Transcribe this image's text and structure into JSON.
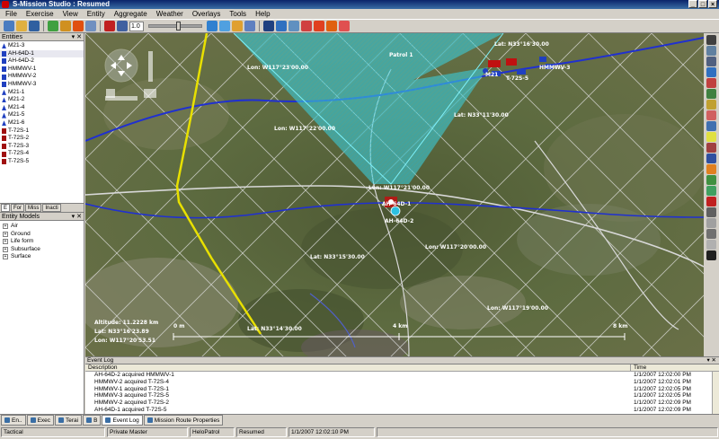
{
  "window": {
    "title": "S-Mission Studio : Resumed"
  },
  "menu": [
    "File",
    "Exercise",
    "View",
    "Entity",
    "Aggregate",
    "Weather",
    "Overlays",
    "Tools",
    "Help"
  ],
  "toolbar": {
    "zoom_value": "1.0"
  },
  "entities_panel": {
    "title": "Entities",
    "items": [
      {
        "label": "M21-3",
        "kind": "blue"
      },
      {
        "label": "AH-64D-1",
        "kind": "heli",
        "selected": true
      },
      {
        "label": "AH-64D-2",
        "kind": "heli"
      },
      {
        "label": "HMMWV-1",
        "kind": "heli"
      },
      {
        "label": "HMMWV-2",
        "kind": "heli"
      },
      {
        "label": "HMMWV-3",
        "kind": "heli"
      },
      {
        "label": "M21-1",
        "kind": "blue"
      },
      {
        "label": "M21-2",
        "kind": "blue"
      },
      {
        "label": "M21-4",
        "kind": "blue"
      },
      {
        "label": "M21-5",
        "kind": "blue"
      },
      {
        "label": "M21-6",
        "kind": "blue"
      },
      {
        "label": "T-72S-1",
        "kind": "red"
      },
      {
        "label": "T-72S-2",
        "kind": "red"
      },
      {
        "label": "T-72S-3",
        "kind": "red"
      },
      {
        "label": "T-72S-4",
        "kind": "red"
      },
      {
        "label": "T-72S-5",
        "kind": "red"
      }
    ]
  },
  "left_tabs": [
    "E",
    "For",
    "Miss",
    "Inacti"
  ],
  "entity_models": {
    "title": "Entity Models",
    "items": [
      "Air",
      "Ground",
      "Life form",
      "Subsurface",
      "Surface"
    ]
  },
  "map": {
    "labels": {
      "lon_1": "Lon: W117°23'00.00",
      "lat_1": "Lat: N33°16'30.00",
      "lon_2": "Lon: W117°22'00.00",
      "lat_2": "Lat: N33°11'30.00",
      "lon_3": "Lon: W117°21'00.00",
      "lon_4": "Lon: W117°20'00.00",
      "lat_3": "Lat: N33°15'30.00",
      "lon_5": "Lon: W117°19'00.00",
      "lat_4": "Lat: N33°14'30.00",
      "patrol": "Patrol 1",
      "unit_m21": "M21",
      "unit_hmmwv": "HMMWV-3",
      "unit_t72": "T-72S-5",
      "unit_ah64d2": "AH-64D-2",
      "unit_ah64d1": "AH-64D-1"
    },
    "readout": {
      "altitude": "Altitude: 11.2228 km",
      "lat": "Lat: N33°16'23.89",
      "lon": "Lon: W117°20'53.51"
    },
    "scale": {
      "left": "0 m",
      "mid": "4 km",
      "right": "8 km"
    }
  },
  "event_log": {
    "title": "Event Log",
    "columns": {
      "description": "Description",
      "time": "Time"
    },
    "rows": [
      {
        "description": "AH-64D-2 acquired HMMWV-1",
        "time": "1/1/2007 12:02:00 PM"
      },
      {
        "description": "HMMWV-2 acquired T-72S-4",
        "time": "1/1/2007 12:02:01 PM"
      },
      {
        "description": "HMMWV-1 acquired T-72S-1",
        "time": "1/1/2007 12:02:05 PM"
      },
      {
        "description": "HMMWV-3 acquired T-72S-5",
        "time": "1/1/2007 12:02:05 PM"
      },
      {
        "description": "HMMWV-2 acquired T-72S-2",
        "time": "1/1/2007 12:02:09 PM"
      },
      {
        "description": "AH-64D-1 acquired T-72S-5",
        "time": "1/1/2007 12:02:09 PM"
      }
    ]
  },
  "bottom_tabs": [
    "En..",
    "Exec",
    "Terai",
    "B",
    "Event Log",
    "Mission Route Properties"
  ],
  "status": {
    "mode": "Tactical",
    "user": "Private Master",
    "mission": "HeloPatrol",
    "state": "Resumed",
    "time": "1/1/2007 12:02:10 PM"
  },
  "colors": {
    "sensor_cone": "#3fd3e0",
    "route": "#e8e000",
    "river": "#2030d0",
    "blue_force": "#2040c0",
    "red_force": "#c01010"
  }
}
